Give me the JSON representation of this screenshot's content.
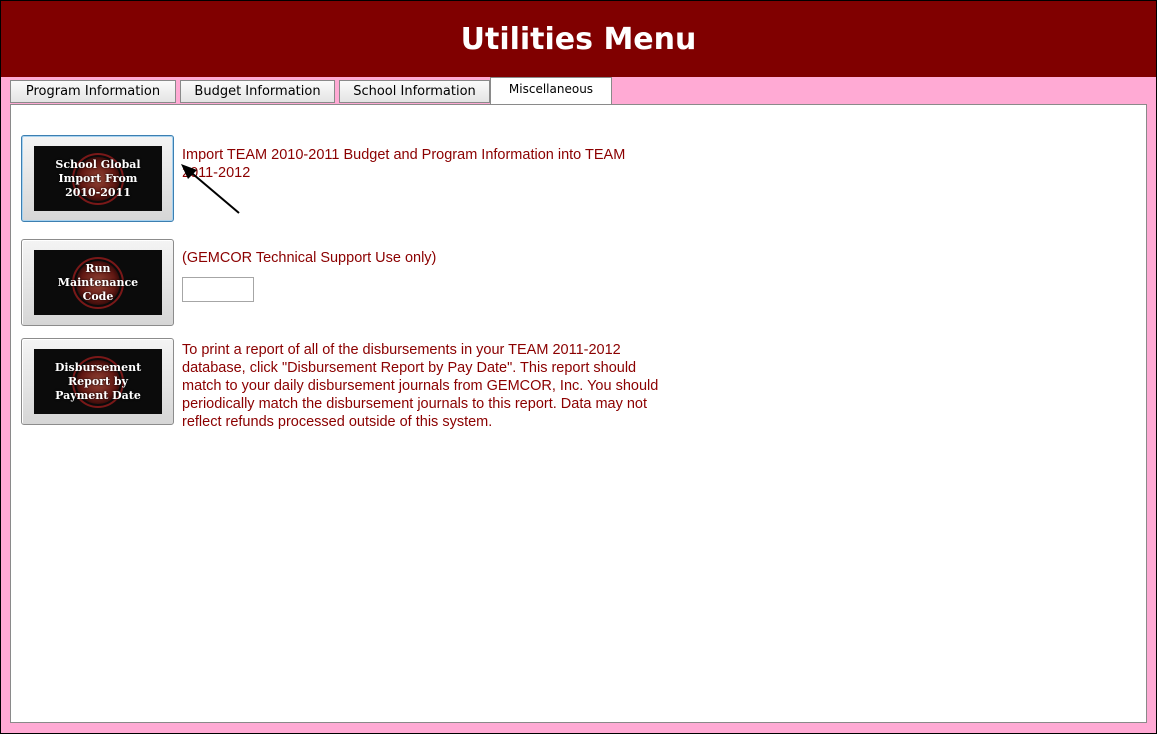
{
  "window": {
    "title": "Utilities Menu"
  },
  "tabs": [
    {
      "label": "Program Information",
      "active": false
    },
    {
      "label": "Budget Information",
      "active": false
    },
    {
      "label": "School Information",
      "active": false
    },
    {
      "label": "Miscellaneous",
      "active": true
    }
  ],
  "actions": [
    {
      "button_label": "School Global\nImport From\n2010-2011",
      "description": "Import TEAM 2010-2011 Budget and Program Information into TEAM 2011-2012"
    },
    {
      "button_label": "Run\nMaintenance\nCode",
      "description": "(GEMCOR Technical Support Use only)",
      "input_value": ""
    },
    {
      "button_label": "Disbursement\nReport by\nPayment Date",
      "description": "To print a report of all of the disbursements in your TEAM 2011-2012 database, click \"Disbursement Report by Pay Date\".  This report should match to your daily disbursement journals from GEMCOR, Inc.  You should periodically match the disbursement journals to this report.  Data may not reflect refunds processed outside of this system."
    }
  ],
  "colors": {
    "title_bar": "#800000",
    "frame_pink": "#ffaad4",
    "description_text": "#8b0000"
  },
  "icons": {
    "button_emblem": "red-circle-emblem-icon",
    "annotation_arrow": "arrow-annotation-icon"
  }
}
